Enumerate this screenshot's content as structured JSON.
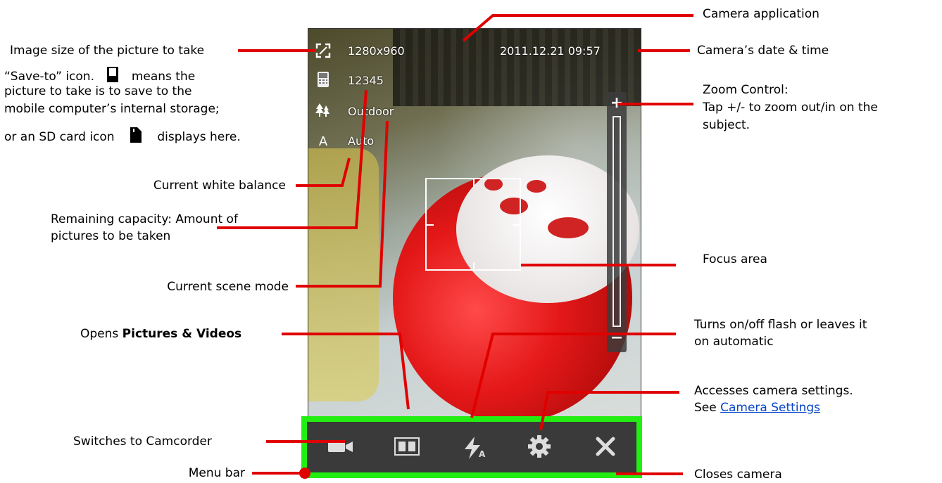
{
  "screen": {
    "resolution": "1280x960",
    "datetime": "2011.12.21 09:57",
    "remaining": "12345",
    "scene_mode": "Outdoor",
    "white_balance": "Auto",
    "white_balance_glyph": "A",
    "zoom_plus": "+",
    "zoom_minus": "−"
  },
  "menu_bar": {
    "items": [
      {
        "name": "camcorder-icon"
      },
      {
        "name": "pictures-videos-icon"
      },
      {
        "name": "flash-auto-icon"
      },
      {
        "name": "settings-gear-icon"
      },
      {
        "name": "close-x-icon"
      }
    ],
    "flash_sub": "A"
  },
  "labels": {
    "image_size": "Image size of the picture to take",
    "save_to_1": "“Save-to” icon.",
    "save_to_1b": "means the",
    "save_to_2": "picture to take is to save to the",
    "save_to_3": "mobile computer’s internal storage;",
    "save_to_4a": "or an SD card icon",
    "save_to_4b": "displays here.",
    "white_balance": "Current white balance",
    "remaining_1": "Remaining capacity: Amount of",
    "remaining_2": "pictures to be taken",
    "scene_mode": "Current scene mode",
    "opens_prefix": "Opens ",
    "opens_bold": "Pictures & Videos",
    "switches": "Switches to Camcorder",
    "menu_bar": "Menu bar",
    "camera_app": "Camera application",
    "date_time": "Camera’s date & time",
    "zoom_1": "Zoom Control:",
    "zoom_2": "Tap +/- to zoom out/in on the",
    "zoom_3": "subject.",
    "focus": "Focus area",
    "flash_1": "Turns on/off flash or leaves it",
    "flash_2": "on automatic",
    "settings_1": "Accesses camera settings.",
    "settings_2": "See ",
    "settings_link": "Camera Settings",
    "closes": "Closes camera"
  },
  "colors": {
    "leader_line": "#e00000",
    "menu_bar_highlight": "#22ee11",
    "link": "#0645c8"
  }
}
